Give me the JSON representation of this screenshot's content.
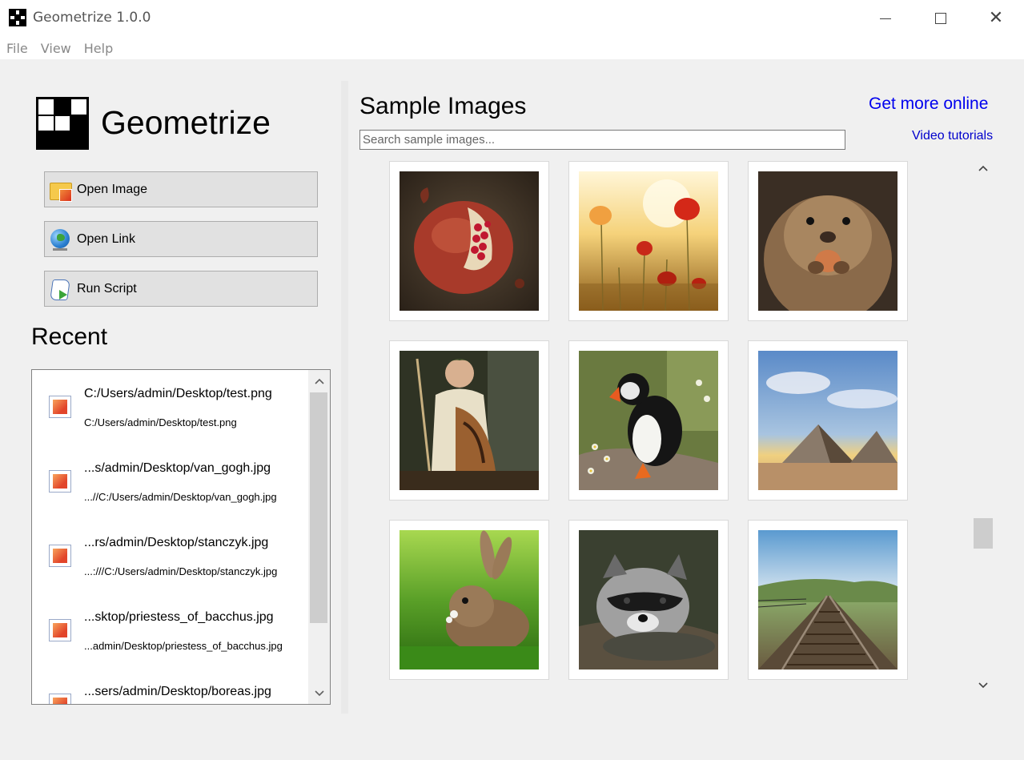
{
  "window": {
    "title": "Geometrize 1.0.0"
  },
  "menu": [
    "File",
    "View",
    "Help"
  ],
  "brand": {
    "name": "Geometrize"
  },
  "actions": {
    "open_image": "Open Image",
    "open_link": "Open Link",
    "run_script": "Run Script"
  },
  "recent": {
    "title": "Recent",
    "items": [
      {
        "name": "C:/Users/admin/Desktop/test.png",
        "path": "C:/Users/admin/Desktop/test.png"
      },
      {
        "name": "...s/admin/Desktop/van_gogh.jpg",
        "path": "...//C:/Users/admin/Desktop/van_gogh.jpg"
      },
      {
        "name": "...rs/admin/Desktop/stanczyk.jpg",
        "path": "...:///C:/Users/admin/Desktop/stanczyk.jpg"
      },
      {
        "name": "...sktop/priestess_of_bacchus.jpg",
        "path": "...admin/Desktop/priestess_of_bacchus.jpg"
      },
      {
        "name": "...sers/admin/Desktop/boreas.jpg",
        "path": ""
      }
    ]
  },
  "samples": {
    "title": "Sample Images",
    "search_placeholder": "Search sample images...",
    "get_more_label": "Get more online",
    "video_tutorials_label": "Video tutorials",
    "images": [
      {
        "subject": "pomegranate"
      },
      {
        "subject": "poppies"
      },
      {
        "subject": "marmot"
      },
      {
        "subject": "bacchus-painting"
      },
      {
        "subject": "puffin"
      },
      {
        "subject": "pyramids"
      },
      {
        "subject": "rabbit"
      },
      {
        "subject": "raccoon"
      },
      {
        "subject": "railway-tracks"
      }
    ]
  },
  "icons": {
    "scroll_up": "chevron-up-icon",
    "scroll_down": "chevron-down-icon"
  }
}
